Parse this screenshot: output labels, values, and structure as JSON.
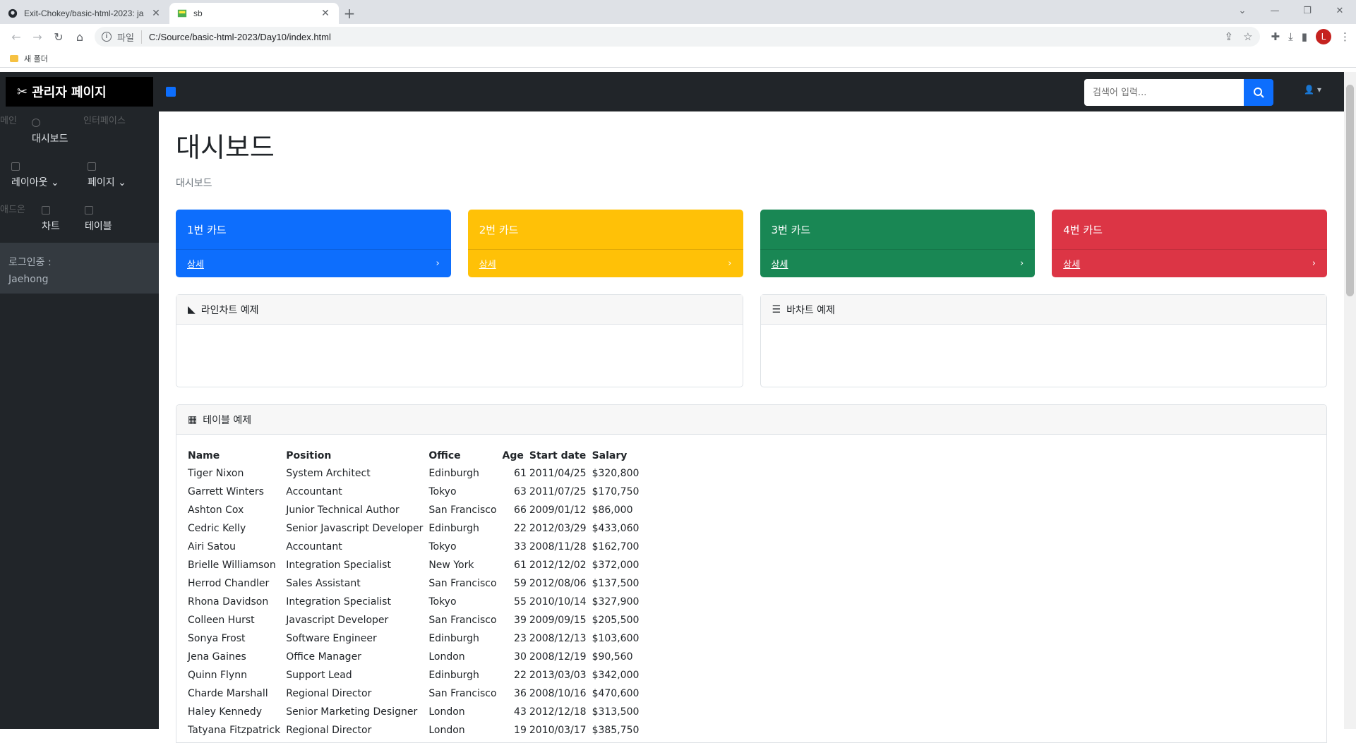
{
  "browser": {
    "tabs": [
      {
        "title": "Exit-Chokey/basic-html-2023: ja",
        "active": false
      },
      {
        "title": "sb",
        "active": true
      }
    ],
    "scheme_label": "파일",
    "url": "C:/Source/basic-html-2023/Day10/index.html",
    "profile_initial": "L",
    "bookmark_folder": "새 폴더"
  },
  "topnav": {
    "brand": "관리자 페이지",
    "search_placeholder": "검색어 입력..."
  },
  "sidebar": {
    "heading_main": "메인",
    "heading_interface": "인터페이스",
    "heading_addons": "애드온",
    "dashboard": "대시보드",
    "layout": "레이아웃",
    "pages": "페이지",
    "charts": "차트",
    "tables": "테이블",
    "login_label": "로그인중 :",
    "login_user": "Jaehong"
  },
  "main": {
    "title": "대시보드",
    "breadcrumb": "대시보드",
    "cards": [
      {
        "title": "1번 카드",
        "link": "상세",
        "color": "#0d6efd"
      },
      {
        "title": "2번 카드",
        "link": "상세",
        "color": "#ffc107"
      },
      {
        "title": "3번 카드",
        "link": "상세",
        "color": "#198754"
      },
      {
        "title": "4번 카드",
        "link": "상세",
        "color": "#dc3545"
      }
    ],
    "line_chart_title": "라인차트 예제",
    "bar_chart_title": "바차트 예제",
    "table_title": "테이블 예제"
  },
  "table": {
    "headers": [
      "Name",
      "Position",
      "Office",
      "Age",
      "Start date",
      "Salary"
    ],
    "rows": [
      [
        "Tiger Nixon",
        "System Architect",
        "Edinburgh",
        "61",
        "2011/04/25",
        "$320,800"
      ],
      [
        "Garrett Winters",
        "Accountant",
        "Tokyo",
        "63",
        "2011/07/25",
        "$170,750"
      ],
      [
        "Ashton Cox",
        "Junior Technical Author",
        "San Francisco",
        "66",
        "2009/01/12",
        "$86,000"
      ],
      [
        "Cedric Kelly",
        "Senior Javascript Developer",
        "Edinburgh",
        "22",
        "2012/03/29",
        "$433,060"
      ],
      [
        "Airi Satou",
        "Accountant",
        "Tokyo",
        "33",
        "2008/11/28",
        "$162,700"
      ],
      [
        "Brielle Williamson",
        "Integration Specialist",
        "New York",
        "61",
        "2012/12/02",
        "$372,000"
      ],
      [
        "Herrod Chandler",
        "Sales Assistant",
        "San Francisco",
        "59",
        "2012/08/06",
        "$137,500"
      ],
      [
        "Rhona Davidson",
        "Integration Specialist",
        "Tokyo",
        "55",
        "2010/10/14",
        "$327,900"
      ],
      [
        "Colleen Hurst",
        "Javascript Developer",
        "San Francisco",
        "39",
        "2009/09/15",
        "$205,500"
      ],
      [
        "Sonya Frost",
        "Software Engineer",
        "Edinburgh",
        "23",
        "2008/12/13",
        "$103,600"
      ],
      [
        "Jena Gaines",
        "Office Manager",
        "London",
        "30",
        "2008/12/19",
        "$90,560"
      ],
      [
        "Quinn Flynn",
        "Support Lead",
        "Edinburgh",
        "22",
        "2013/03/03",
        "$342,000"
      ],
      [
        "Charde Marshall",
        "Regional Director",
        "San Francisco",
        "36",
        "2008/10/16",
        "$470,600"
      ],
      [
        "Haley Kennedy",
        "Senior Marketing Designer",
        "London",
        "43",
        "2012/12/18",
        "$313,500"
      ],
      [
        "Tatyana Fitzpatrick",
        "Regional Director",
        "London",
        "19",
        "2010/03/17",
        "$385,750"
      ]
    ]
  }
}
